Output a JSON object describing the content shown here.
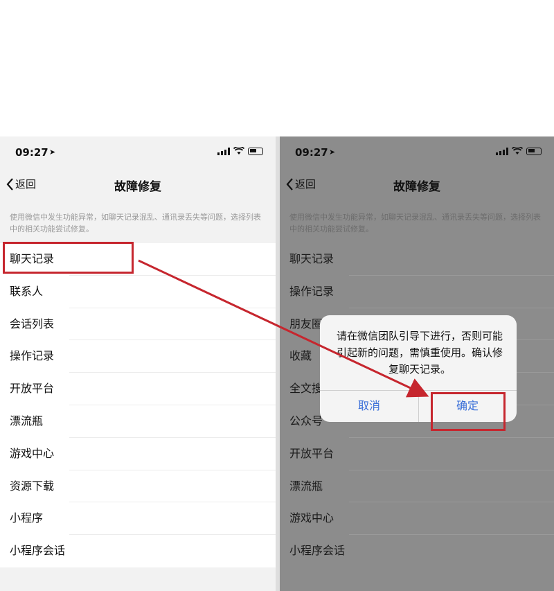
{
  "status": {
    "time": "09:27"
  },
  "nav": {
    "back_label": "返回",
    "title": "故障修复"
  },
  "description": "使用微信中发生功能异常，如聊天记录混乱、通讯录丢失等问题，选择列表中的相关功能尝试修复。",
  "left_list": [
    "聊天记录",
    "联系人",
    "会话列表",
    "操作记录",
    "开放平台",
    "漂流瓶",
    "游戏中心",
    "资源下载",
    "小程序",
    "小程序会话"
  ],
  "right_list": [
    "聊天记录",
    "操作记录",
    "朋友圈",
    "收藏",
    "全文搜索",
    "公众号",
    "开放平台",
    "漂流瓶",
    "游戏中心",
    "小程序会话"
  ],
  "dialog": {
    "message": "请在微信团队引导下进行，否则可能引起新的问题，需慎重使用。确认修复聊天记录。",
    "cancel_label": "取消",
    "confirm_label": "确定"
  },
  "colors": {
    "highlight": "#c6262e",
    "dialog_button": "#3a6fd8"
  }
}
